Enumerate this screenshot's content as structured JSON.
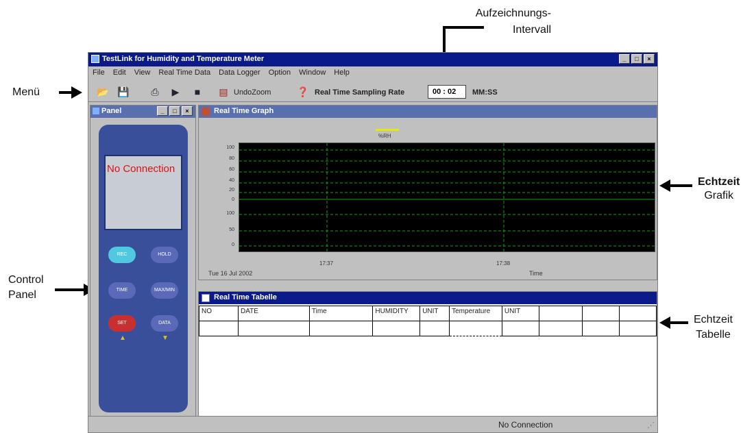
{
  "annotations": {
    "interval": "Aufzeichnungs-\nIntervall",
    "menu": "Menü",
    "control_panel": "Control\nPanel",
    "graph": [
      "Echtzeit",
      "Grafik"
    ],
    "table": [
      "Echtzeit",
      "Tabelle"
    ]
  },
  "window": {
    "title": "TestLink for Humidity and Temperature Meter",
    "controls": [
      "_",
      "□",
      "×"
    ]
  },
  "menu": [
    "File",
    "Edit",
    "View",
    "Real Time Data",
    "Data Logger",
    "Option",
    "Window",
    "Help"
  ],
  "toolbar": {
    "undo_zoom": "UndoZoom",
    "rate_label": "Real Time Sampling Rate",
    "rate_value": "00 : 02",
    "rate_unit": "MM:SS"
  },
  "panel": {
    "title": "Panel",
    "lcd_text": "No Connection",
    "buttons": [
      "REC",
      "HOLD",
      "TIME",
      "MAX/MIN",
      "SET",
      "DATA"
    ]
  },
  "graph": {
    "title": "Real Time Graph",
    "legend": "%RH",
    "y_ticks_top": [
      "100",
      "80",
      "60",
      "40",
      "20",
      "0"
    ],
    "y_ticks_bottom": [
      "100",
      "50",
      "0"
    ],
    "x_ticks": [
      "17:37",
      "17:38"
    ],
    "date": "Tue 16 Jul 2002",
    "xlabel": "Time"
  },
  "table": {
    "title": "Real Time Tabelle",
    "headers": [
      "NO",
      "DATE",
      "Time",
      "HUMIDITY",
      "UNIT",
      "Temperature",
      "UNIT",
      "",
      "",
      ""
    ]
  },
  "status": "No Connection",
  "colors": {
    "title_bar": "#0a1a8a",
    "grid": "#19a019",
    "lcd_text": "#e01010"
  }
}
